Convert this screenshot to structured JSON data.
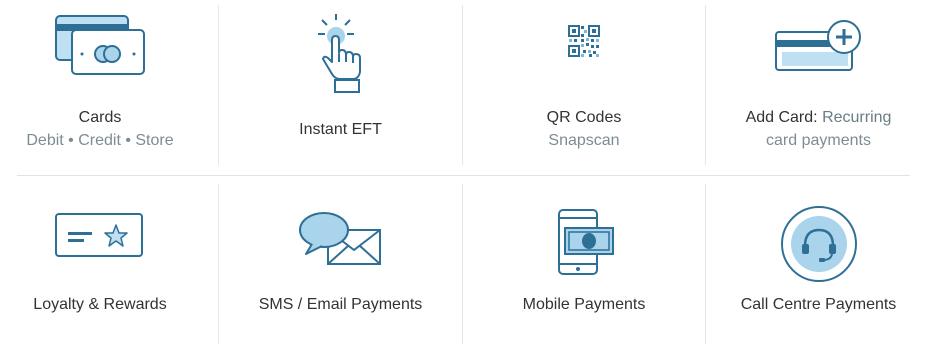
{
  "tiles": [
    {
      "title": "Cards",
      "subtitle": "Debit • Credit • Store",
      "icon": "credit-cards-icon"
    },
    {
      "title": "Instant EFT",
      "subtitle": "",
      "icon": "tap-hand-icon"
    },
    {
      "title": "QR Codes",
      "subtitle": "Snapscan",
      "icon": "qr-code-icon"
    },
    {
      "title": "Add Card:",
      "title_extra": "Recurring",
      "subtitle": "card payments",
      "icon": "add-card-icon"
    },
    {
      "title": "Loyalty & Rewards",
      "subtitle": "",
      "icon": "loyalty-card-icon"
    },
    {
      "title": "SMS / Email Payments",
      "subtitle": "",
      "icon": "sms-email-icon"
    },
    {
      "title": "Mobile Payments",
      "subtitle": "",
      "icon": "mobile-payment-icon"
    },
    {
      "title": "Call Centre Payments",
      "subtitle": "",
      "icon": "headset-icon"
    }
  ],
  "colors": {
    "stroke": "#2e6f96",
    "fill": "#a9d4ec",
    "text": "#333333",
    "muted": "#7d8c93"
  }
}
